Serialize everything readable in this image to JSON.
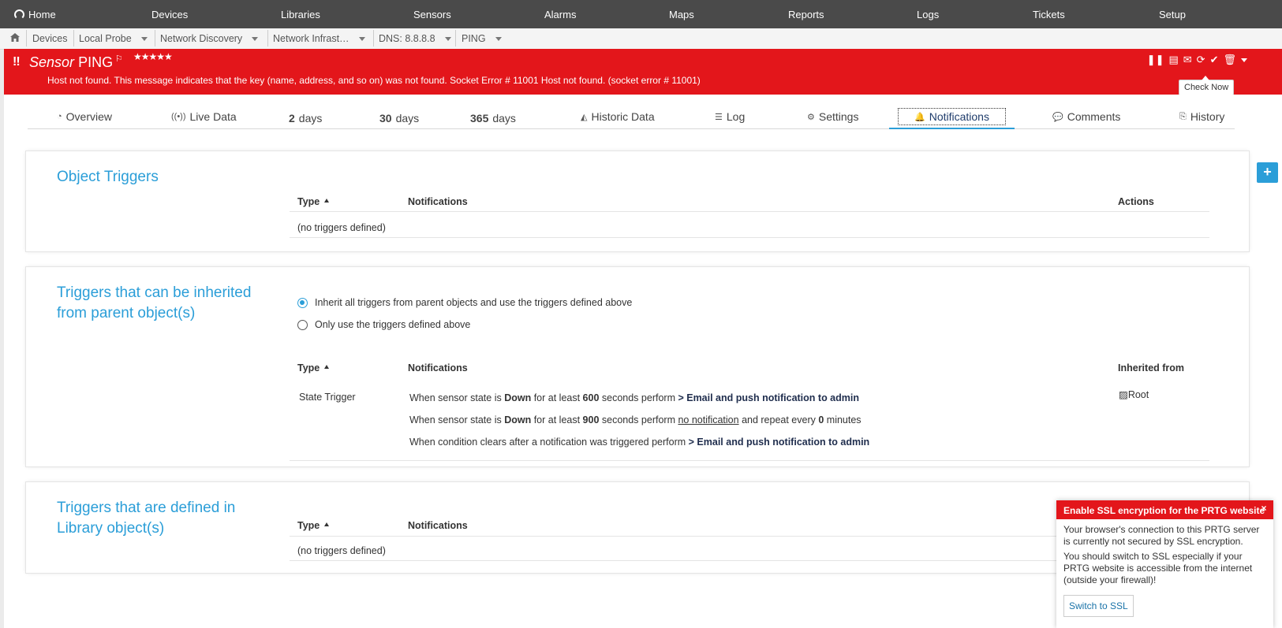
{
  "topnav": {
    "home": "Home",
    "items": [
      "Devices",
      "Libraries",
      "Sensors",
      "Alarms",
      "Maps",
      "Reports",
      "Logs",
      "Tickets",
      "Setup"
    ]
  },
  "breadcrumb": [
    "Devices",
    "Local Probe",
    "Network Discovery",
    "Network Infrast…",
    "DNS: 8.8.8.8",
    "PING"
  ],
  "sensor": {
    "status_mark": "!!",
    "type_label": "Sensor",
    "name": "PING",
    "stars": "★★★★★",
    "message": "Host not found. This message indicates that the key (name, address, and so on) was not found. Socket Error # 11001 Host not found. (socket error # 11001)",
    "tooltip": "Check Now"
  },
  "tabs": {
    "overview": "Overview",
    "live": "Live Data",
    "d2_num": "2",
    "d2_unit": "days",
    "d30_num": "30",
    "d30_unit": "days",
    "d365_num": "365",
    "d365_unit": "days",
    "historic": "Historic Data",
    "log": "Log",
    "settings": "Settings",
    "notifications": "Notifications",
    "comments": "Comments",
    "history": "History"
  },
  "object_triggers": {
    "title": "Object Triggers",
    "col_type": "Type",
    "col_notifications": "Notifications",
    "col_actions": "Actions",
    "empty": "(no triggers defined)"
  },
  "inherited": {
    "title_line1": "Triggers that can be inherited",
    "title_line2": "from parent object(s)",
    "radio_inherit": "Inherit all triggers from parent objects and use the triggers defined above",
    "radio_only": "Only use the triggers defined above",
    "radio_selected": "inherit",
    "col_type": "Type",
    "col_notifications": "Notifications",
    "col_inherited": "Inherited from",
    "row_type": "State Trigger",
    "inherited_from": "Root",
    "line1": {
      "a": "When sensor state is ",
      "state": "Down",
      "b": " for at least ",
      "secs": "600",
      "c": " seconds perform ",
      "action": "> Email and push notification to admin"
    },
    "line2": {
      "a": "When sensor state is ",
      "state": "Down",
      "b": " for at least ",
      "secs": "900",
      "c": " seconds perform ",
      "action": "no notification",
      "d": " and repeat every ",
      "mins": "0",
      "e": " minutes"
    },
    "line3": {
      "a": "When condition clears after a notification was triggered perform ",
      "action": "> Email and push notification to admin"
    }
  },
  "library": {
    "title_line1": "Triggers that are defined in",
    "title_line2": "Library object(s)",
    "col_type": "Type",
    "col_notifications": "Notifications",
    "empty": "(no triggers defined)"
  },
  "ssl": {
    "header": "Enable SSL encryption for the PRTG website",
    "close": "×",
    "p1": "Your browser's connection to this PRTG server is currently not secured by SSL encryption.",
    "p2": "You should switch to SSL especially if your PRTG website is accessible from the internet (outside your firewall)!",
    "button": "Switch to SSL"
  },
  "colors": {
    "accent": "#2b9ed8",
    "alert": "#e3161b",
    "nav": "#4a4a4a"
  }
}
